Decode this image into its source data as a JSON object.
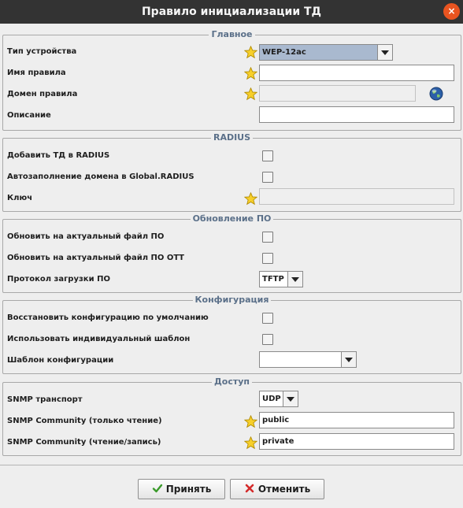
{
  "window": {
    "title": "Правило инициализации ТД",
    "close_glyph": "×"
  },
  "sections": {
    "main": {
      "title": "Главное",
      "device_type_label": "Тип устройства",
      "device_type_value": "WEP-12ac",
      "rule_name_label": "Имя правила",
      "rule_name_value": "",
      "rule_domain_label": "Домен правила",
      "rule_domain_value": "",
      "description_label": "Описание",
      "description_value": ""
    },
    "radius": {
      "title": "RADIUS",
      "add_ap_label": "Добавить ТД в RADIUS",
      "autofill_label": "Автозаполнение домена в Global.RADIUS",
      "key_label": "Ключ",
      "key_value": ""
    },
    "firmware": {
      "title": "Обновление  ПО",
      "update_actual_label": "Обновить на актуальный файл ПО",
      "update_ott_label": "Обновить на актуальный файл ПО ОТТ",
      "protocol_label": "Протокол загрузки ПО",
      "protocol_value": "TFTP"
    },
    "config": {
      "title": "Конфигурация",
      "restore_default_label": "Восстановить конфигурацию по умолчанию",
      "individual_template_label": "Использовать индивидуальный шаблон",
      "template_label": "Шаблон конфигурации",
      "template_value": ""
    },
    "access": {
      "title": "Доступ",
      "snmp_transport_label": "SNMP транспорт",
      "snmp_transport_value": "UDP",
      "snmp_ro_label": "SNMP Community (только чтение)",
      "snmp_ro_value": "public",
      "snmp_rw_label": "SNMP Community (чтение/запись)",
      "snmp_rw_value": "private"
    }
  },
  "buttons": {
    "accept_label": "Принять",
    "cancel_label": "Отменить"
  },
  "colors": {
    "accent": "#e95420",
    "legend": "#5b7089",
    "selected_combo": "#a9b9cf",
    "star": "#f4c20d"
  },
  "icons": {
    "required": "star-icon",
    "domain": "globe-icon",
    "accept": "check-icon",
    "cancel": "x-icon"
  }
}
